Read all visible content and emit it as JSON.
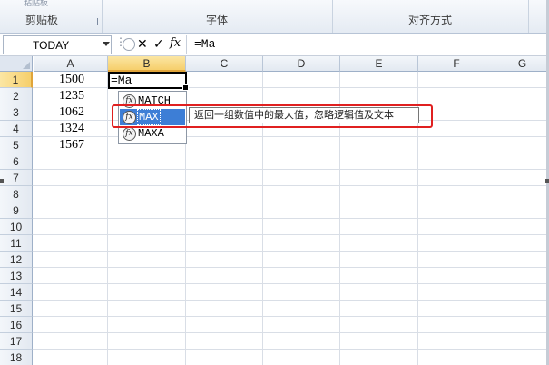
{
  "ribbon": {
    "clipboard_top": "粘贴板",
    "groups": [
      {
        "label": "剪贴板"
      },
      {
        "label": "字体"
      },
      {
        "label": "对齐方式"
      }
    ]
  },
  "formula_bar": {
    "name_box": "TODAY",
    "cancel_symbol": "✕",
    "enter_symbol": "✓",
    "fx_symbol": "fx",
    "formula": "=Ma"
  },
  "sheet": {
    "columns": [
      "A",
      "B",
      "C",
      "D",
      "E",
      "F",
      "G"
    ],
    "rows": [
      "1",
      "2",
      "3",
      "4",
      "5",
      "6",
      "7",
      "8",
      "9",
      "10",
      "11",
      "12",
      "13",
      "14",
      "15",
      "16",
      "17",
      "18"
    ],
    "col_a_values": [
      "1500",
      "1235",
      "1062",
      "1324",
      "1567"
    ],
    "active_cell_text": "=Ma"
  },
  "autocomplete": {
    "items": [
      "MATCH",
      "MAX",
      "MAXA"
    ],
    "selected": "MAX",
    "icon": "fx-function-icon",
    "tooltip": "返回一组数值中的最大值，忽略逻辑值及文本"
  },
  "colors": {
    "highlight": "#3d7ed6",
    "annotation_box": "#e02020",
    "selected_header": "#f6cf6c"
  }
}
